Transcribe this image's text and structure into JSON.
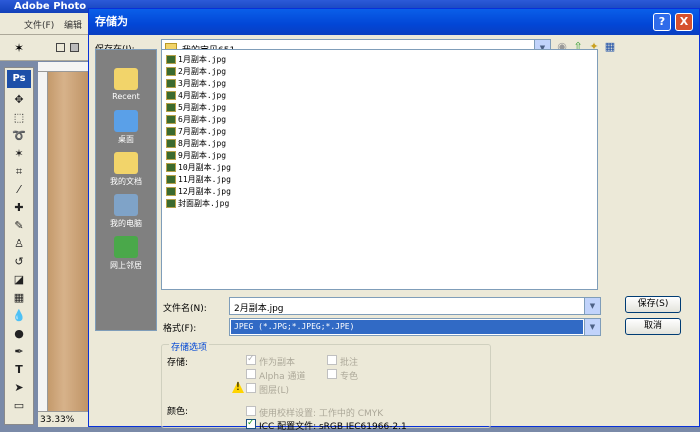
{
  "photoshop": {
    "title": "Adobe Photo",
    "menu": [
      "文件(F)",
      "编辑"
    ],
    "logo": "Ps",
    "zoom": "33.33%"
  },
  "dialog": {
    "title": "存储为",
    "help": "?",
    "close": "X",
    "save_in_label": "保存在(I):",
    "save_in_value": "我的宝贝651",
    "places": [
      "Recent",
      "桌面",
      "我的文档",
      "我的电脑",
      "网上邻居"
    ],
    "files": [
      "1月副本.jpg",
      "2月副本.jpg",
      "3月副本.jpg",
      "4月副本.jpg",
      "5月副本.jpg",
      "6月副本.jpg",
      "7月副本.jpg",
      "8月副本.jpg",
      "9月副本.jpg",
      "10月副本.jpg",
      "11月副本.jpg",
      "12月副本.jpg",
      "封面副本.jpg"
    ],
    "filename_label": "文件名(N):",
    "filename_value": "2月副本.jpg",
    "format_label": "格式(F):",
    "format_value": "JPEG (*.JPG;*.JPEG;*.JPE)",
    "save_button": "保存(S)",
    "cancel_button": "取消",
    "options_title": "存储选项",
    "store_label": "存储:",
    "as_copy": "作为副本",
    "annotations": "批注",
    "alpha": "Alpha 通道",
    "spot": "专色",
    "layers": "图层(L)",
    "color_label": "颜色:",
    "proof": "使用校样设置: 工作中的 CMYK",
    "icc": "ICC 配置文件: sRGB IEC61966-2.1"
  }
}
